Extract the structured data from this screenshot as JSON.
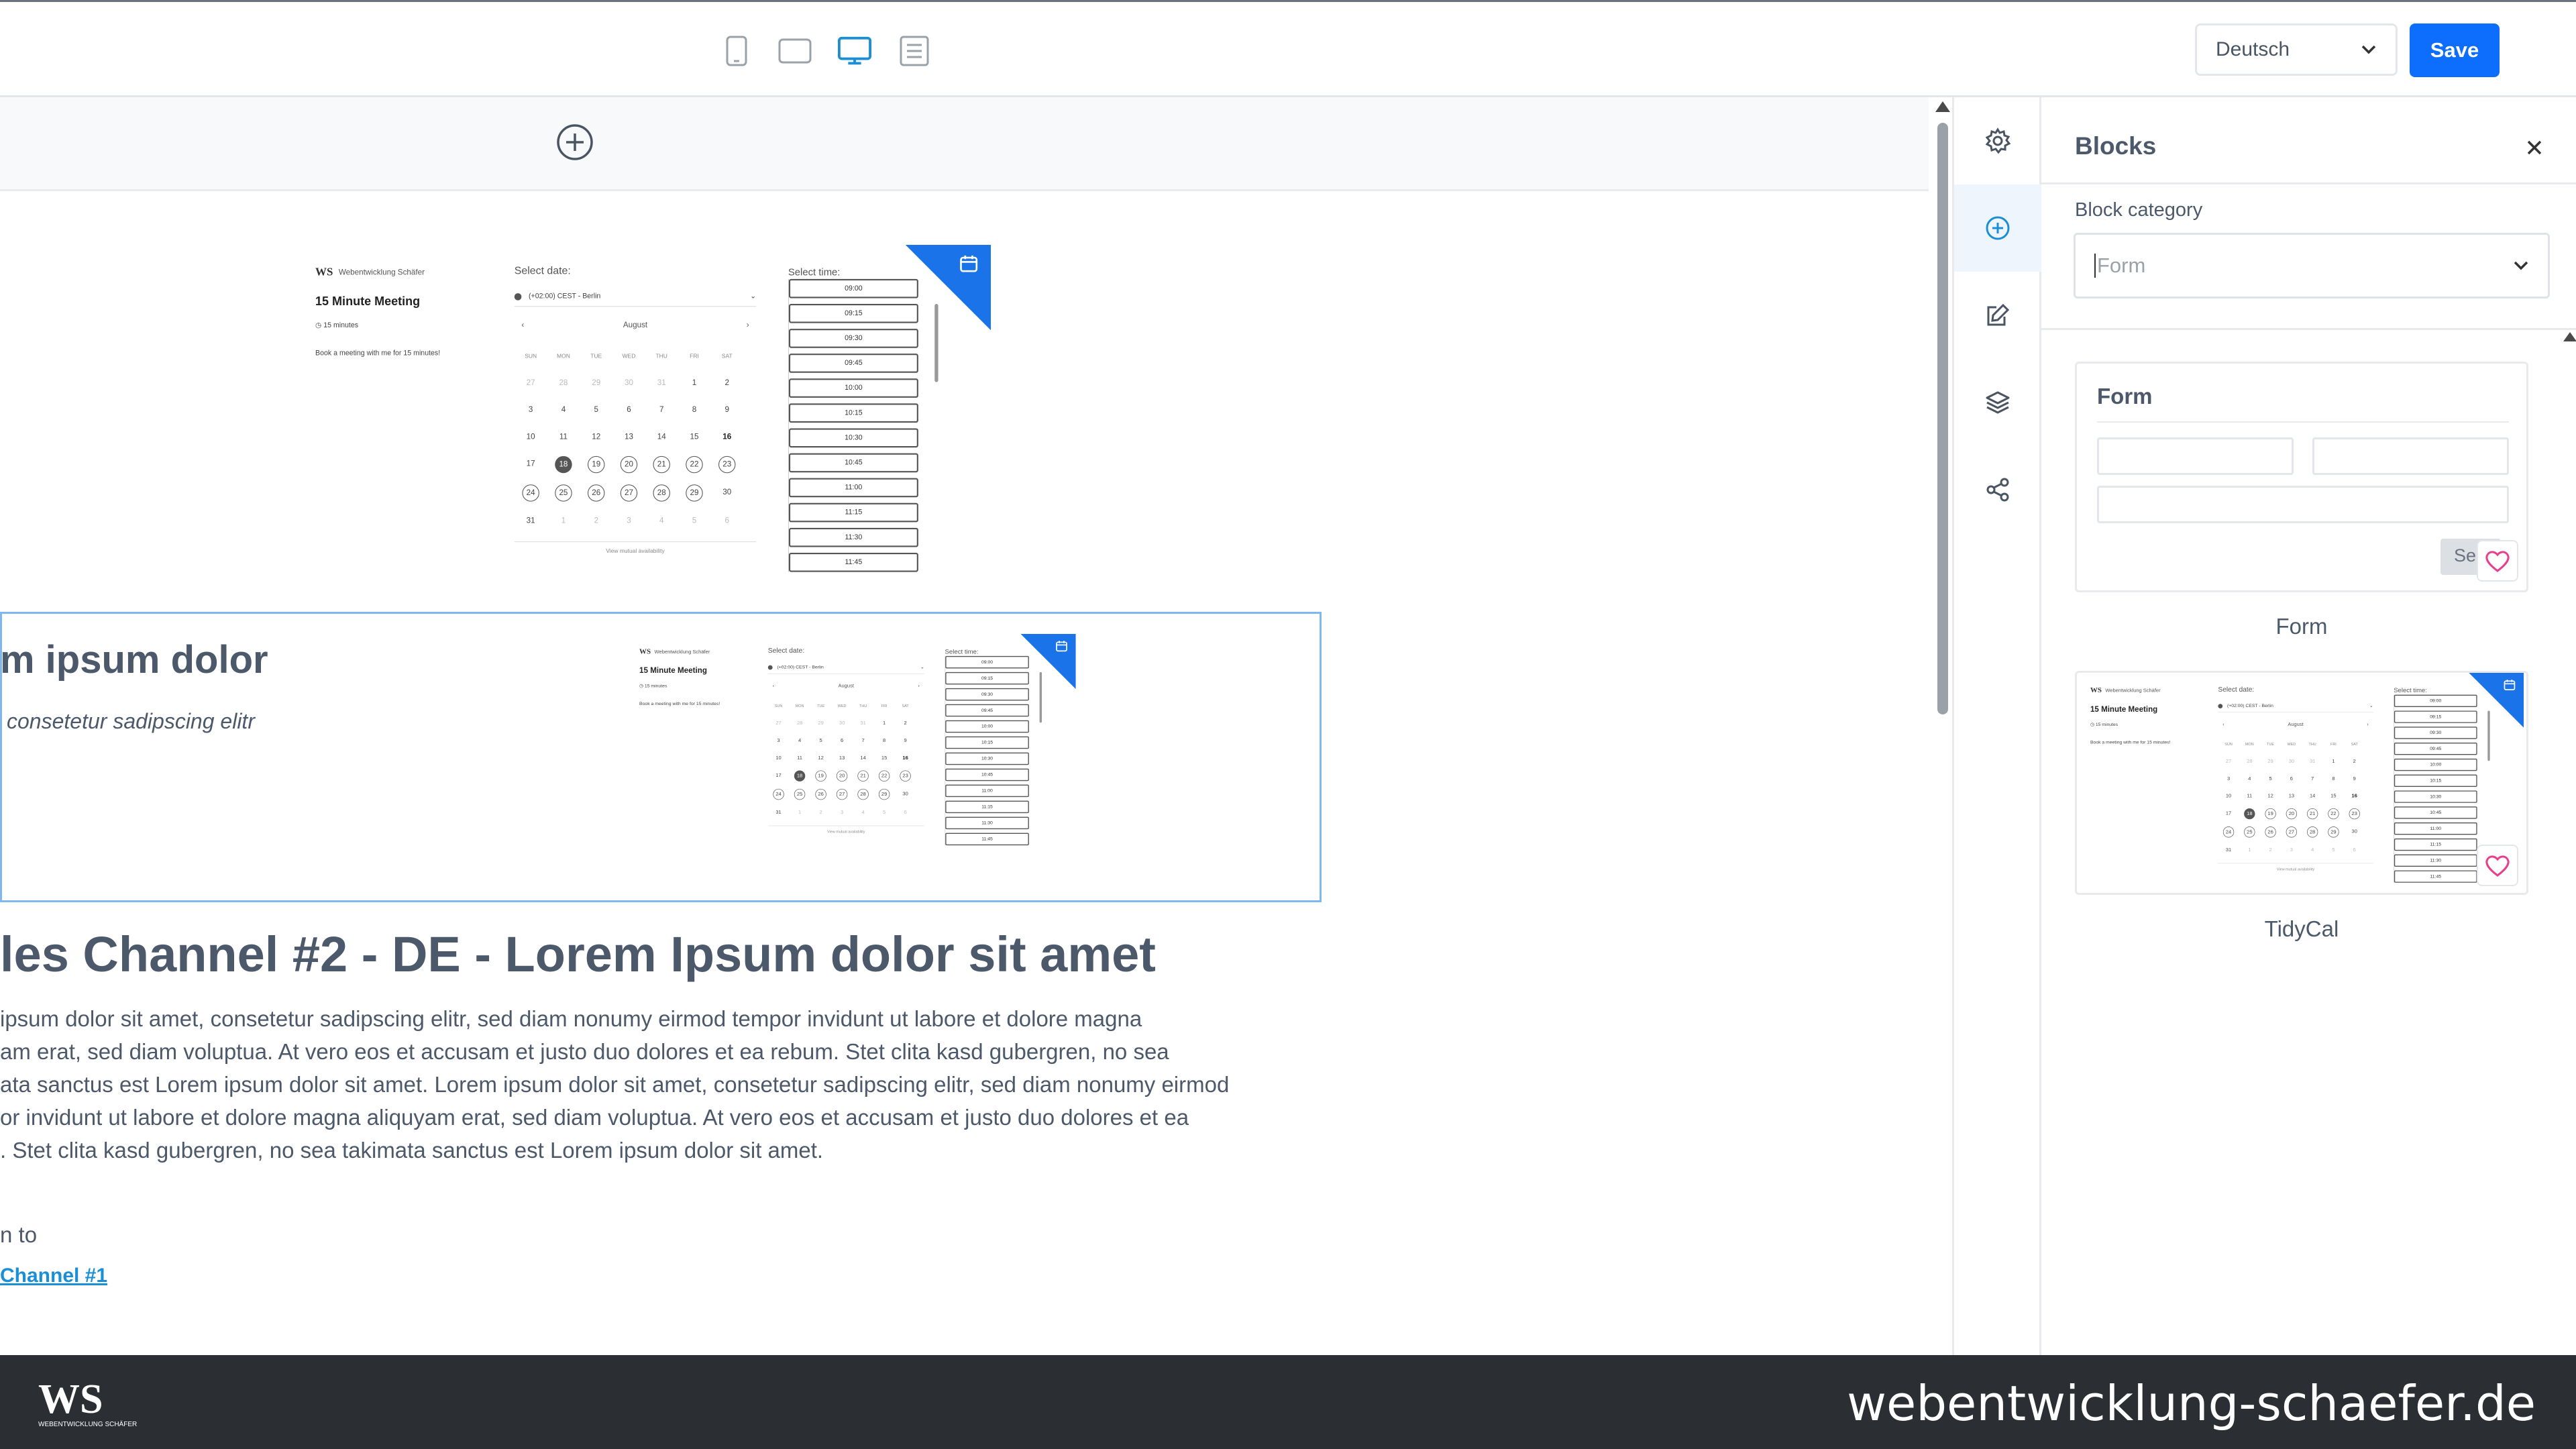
{
  "toolbar": {
    "devices": [
      "phone-device-icon",
      "tablet-device-icon",
      "desktop-device-icon",
      "document-device-icon"
    ],
    "active_device": "desktop",
    "language": "Deutsch",
    "save_label": "Save",
    "accent_color": "#0d6efd"
  },
  "tidycal": {
    "brand": "Webentwicklung Schäfer",
    "logo": "WS",
    "title": "15 Minute Meeting",
    "duration": "15 minutes",
    "description": "Book a meeting with me for 15 minutes!",
    "select_date": "Select date:",
    "timezone": "(+02:00) CEST - Berlin",
    "month": "August",
    "weekdays": [
      "SUN",
      "MON",
      "TUE",
      "WED",
      "THU",
      "FRI",
      "SAT"
    ],
    "weeks": [
      [
        "27",
        "28",
        "29",
        "30",
        "31",
        "1",
        "2"
      ],
      [
        "3",
        "4",
        "5",
        "6",
        "7",
        "8",
        "9"
      ],
      [
        "10",
        "11",
        "12",
        "13",
        "14",
        "15",
        "16"
      ],
      [
        "17",
        "18",
        "19",
        "20",
        "21",
        "22",
        "23"
      ],
      [
        "24",
        "25",
        "26",
        "27",
        "28",
        "29",
        "30"
      ],
      [
        "31",
        "1",
        "2",
        "3",
        "4",
        "5",
        "6"
      ]
    ],
    "mutual": "View mutual availability",
    "select_time": "Select time:",
    "times": [
      "09:00",
      "09:15",
      "09:30",
      "09:45",
      "10:00",
      "10:15",
      "10:30",
      "10:45",
      "11:00",
      "11:15",
      "11:30",
      "11:45"
    ]
  },
  "content": {
    "hero_title": "m ipsum dolor",
    "hero_sub": " consetetur sadipscing elitr",
    "section_title": "les Channel #2 - DE - Lorem Ipsum dolor sit amet",
    "paragraph_lines": [
      " ipsum dolor sit amet, consetetur sadipscing elitr, sed diam nonumy eirmod tempor invidunt ut labore et dolore magna",
      "am erat, sed diam voluptua. At vero eos et accusam et justo duo dolores et ea rebum. Stet clita kasd gubergren, no sea",
      "ata sanctus est Lorem ipsum dolor sit amet. Lorem ipsum dolor sit amet, consetetur sadipscing elitr, sed diam nonumy eirmod",
      "or invidunt ut labore et dolore magna aliquyam erat, sed diam voluptua. At vero eos et accusam et justo duo dolores et ea",
      ". Stet clita kasd gubergren, no sea takimata sanctus est Lorem ipsum dolor sit amet."
    ],
    "small_line": "n to",
    "link": "Channel #1"
  },
  "rail": {
    "items": [
      "gear-icon",
      "add-circle-icon",
      "edit-icon",
      "layers-icon",
      "share-icon"
    ],
    "active": "add-circle-icon"
  },
  "panel": {
    "title": "Blocks",
    "category_label": "Block category",
    "category_placeholder": "Form",
    "blocks": [
      {
        "name": "Form",
        "preview_title": "Form",
        "button_label": "Se"
      },
      {
        "name": "TidyCal"
      }
    ]
  },
  "footer": {
    "logo_text": "WS",
    "logo_sub": "WEBENTWICKLUNG SCHÄFER",
    "url": "webentwicklung-schaefer.de"
  }
}
